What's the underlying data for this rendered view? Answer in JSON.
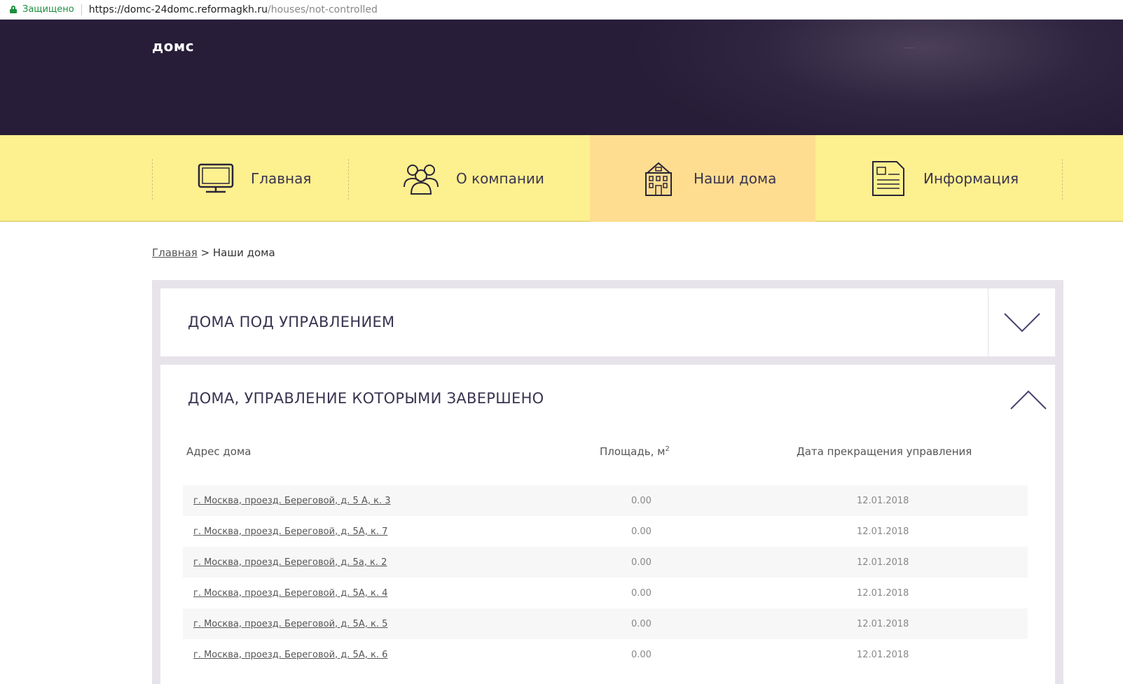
{
  "browser": {
    "secure_label": "Защищено",
    "url_host": "https://domc-24domc.reformagkh.ru",
    "url_path": "/houses/not-controlled"
  },
  "header": {
    "logo": "домс"
  },
  "nav": {
    "items": [
      {
        "label": "Главная",
        "icon": "monitor-icon"
      },
      {
        "label": "О компании",
        "icon": "people-icon"
      },
      {
        "label": "Наши дома",
        "icon": "building-icon",
        "active": true
      },
      {
        "label": "Информация",
        "icon": "document-icon"
      }
    ]
  },
  "breadcrumb": {
    "home": "Главная",
    "separator": " > ",
    "current": "Наши дома"
  },
  "sections": {
    "managed": {
      "title": "ДОМА ПОД УПРАВЛЕНИЕМ"
    },
    "ended": {
      "title": "ДОМА, УПРАВЛЕНИЕ КОТОРЫМИ ЗАВЕРШЕНО",
      "columns": {
        "address": "Адрес дома",
        "area": "Площадь, м",
        "area_sup": "2",
        "date": "Дата прекращения управления"
      },
      "rows": [
        {
          "address": "г. Москва, проезд. Береговой, д. 5 А, к. 3",
          "area": "0.00",
          "date": "12.01.2018"
        },
        {
          "address": "г. Москва, проезд. Береговой, д. 5А, к. 7",
          "area": "0.00",
          "date": "12.01.2018"
        },
        {
          "address": "г. Москва, проезд. Береговой, д. 5а, к. 2",
          "area": "0.00",
          "date": "12.01.2018"
        },
        {
          "address": "г. Москва, проезд. Береговой, д. 5А, к. 4",
          "area": "0.00",
          "date": "12.01.2018"
        },
        {
          "address": "г. Москва, проезд. Береговой, д. 5А, к. 5",
          "area": "0.00",
          "date": "12.01.2018"
        },
        {
          "address": "г. Москва, проезд. Береговой, д. 5А, к. 6",
          "area": "0.00",
          "date": "12.01.2018"
        }
      ]
    }
  },
  "colors": {
    "hero": "#2f2541",
    "nav": "#fdf08f",
    "nav_active": "#fedd90",
    "accent": "#3b3450"
  }
}
